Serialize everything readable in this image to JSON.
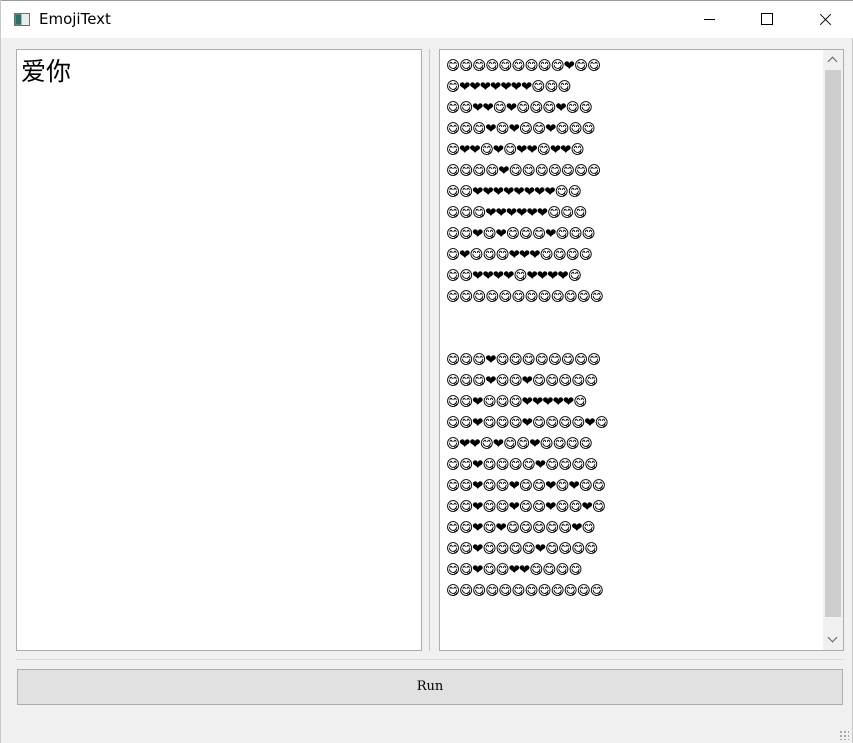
{
  "window": {
    "title": "EmojiText",
    "app_icon": "app-window-icon"
  },
  "input": {
    "text": "爱你"
  },
  "output": {
    "text": "😋😋😋😋😋😋😋😋😋❤😋😋\n😋❤❤❤❤❤❤❤😋😋😋\n😋😋❤❤😋❤😋😋😋❤😋😋\n😋😋😋❤😋❤😋😋❤😋😋😋\n😋❤❤😋❤😋❤❤😋❤❤😋\n😋😋😋😋❤😋😋😋😋😋😋😋\n😋😋❤❤❤❤❤❤❤❤😋😋\n😋😋😋❤❤❤❤❤❤😋😋😋\n😋😋❤😋❤😋😋😋❤😋😋😋\n😋❤😋😋😋❤❤❤😋😋😋😋\n😋😋❤❤❤❤😋❤❤❤❤😋\n😋😋😋😋😋😋😋😋😋😋😋😋\n\n\n😋😋😋❤😋😋😋😋😋😋😋😋\n😋😋😋❤😋😋❤😋😋😋😋😋\n😋😋❤😋😋😋❤❤❤❤❤😋\n😋😋❤😋😋😋❤😋😋😋😋❤😋\n😋❤❤😋❤😋😋❤😋😋😋😋\n😋😋❤😋😋😋😋❤😋😋😋😋\n😋😋❤😋😋❤😋😋❤😋❤😋😋\n😋😋❤😋😋❤😋😋❤😋😋❤😋\n😋😋❤😋❤😋😋😋😋😋❤😋\n😋😋❤😋😋😋😋❤😋😋😋😋\n😋😋❤😋😋❤❤😋😋😋😋\n😋😋😋😋😋😋😋😋😋😋😋😋"
  },
  "buttons": {
    "run_label": "Run"
  }
}
